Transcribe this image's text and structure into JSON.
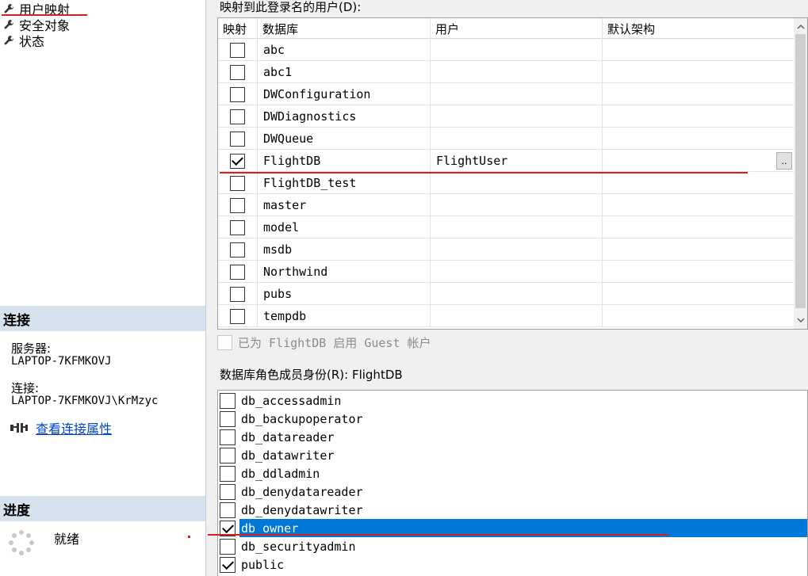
{
  "left": {
    "pages": [
      {
        "label": "用户映射",
        "icon": "wrench-icon"
      },
      {
        "label": "安全对象",
        "icon": "wrench-icon"
      },
      {
        "label": "状态",
        "icon": "wrench-icon"
      }
    ],
    "connection": {
      "heading": "连接",
      "server_label": "服务器:",
      "server_value": "LAPTOP-7KFMKOVJ",
      "conn_label": "连接:",
      "conn_value": "LAPTOP-7KFMKOVJ\\KrMzyc",
      "view_link": "查看连接属性",
      "link_icon": "connection-properties-icon"
    },
    "progress": {
      "heading": "进度",
      "status": "就绪",
      "icon": "progress-spinner-icon"
    }
  },
  "users": {
    "label": "映射到此登录名的用户(D):",
    "columns": [
      "映射",
      "数据库",
      "用户",
      "默认架构"
    ],
    "rows": [
      {
        "mapped": false,
        "database": "abc",
        "user": "",
        "schema": ""
      },
      {
        "mapped": false,
        "database": "abc1",
        "user": "",
        "schema": ""
      },
      {
        "mapped": false,
        "database": "DWConfiguration",
        "user": "",
        "schema": ""
      },
      {
        "mapped": false,
        "database": "DWDiagnostics",
        "user": "",
        "schema": ""
      },
      {
        "mapped": false,
        "database": "DWQueue",
        "user": "",
        "schema": ""
      },
      {
        "mapped": true,
        "database": "FlightDB",
        "user": "FlightUser",
        "schema": "",
        "browse": ".."
      },
      {
        "mapped": false,
        "database": "FlightDB_test",
        "user": "",
        "schema": ""
      },
      {
        "mapped": false,
        "database": "master",
        "user": "",
        "schema": ""
      },
      {
        "mapped": false,
        "database": "model",
        "user": "",
        "schema": ""
      },
      {
        "mapped": false,
        "database": "msdb",
        "user": "",
        "schema": ""
      },
      {
        "mapped": false,
        "database": "Northwind",
        "user": "",
        "schema": ""
      },
      {
        "mapped": false,
        "database": "pubs",
        "user": "",
        "schema": ""
      },
      {
        "mapped": false,
        "database": "tempdb",
        "user": "",
        "schema": ""
      }
    ]
  },
  "guest": {
    "label": "已为 FlightDB 启用 Guest 帐户",
    "checked": false,
    "enabled": false
  },
  "roles": {
    "label": "数据库角色成员身份(R): FlightDB",
    "items": [
      {
        "name": "db_accessadmin",
        "checked": false,
        "selected": false
      },
      {
        "name": "db_backupoperator",
        "checked": false,
        "selected": false
      },
      {
        "name": "db_datareader",
        "checked": false,
        "selected": false
      },
      {
        "name": "db_datawriter",
        "checked": false,
        "selected": false
      },
      {
        "name": "db_ddladmin",
        "checked": false,
        "selected": false
      },
      {
        "name": "db_denydatareader",
        "checked": false,
        "selected": false
      },
      {
        "name": "db_denydatawriter",
        "checked": false,
        "selected": false
      },
      {
        "name": "db_owner",
        "checked": true,
        "selected": true
      },
      {
        "name": "db_securityadmin",
        "checked": false,
        "selected": false
      },
      {
        "name": "public",
        "checked": true,
        "selected": false
      }
    ]
  },
  "colors": {
    "selection": "#0078d7",
    "section_header": "#d6e3ef",
    "annotation": "#d81e1e",
    "link": "#0044cc"
  }
}
